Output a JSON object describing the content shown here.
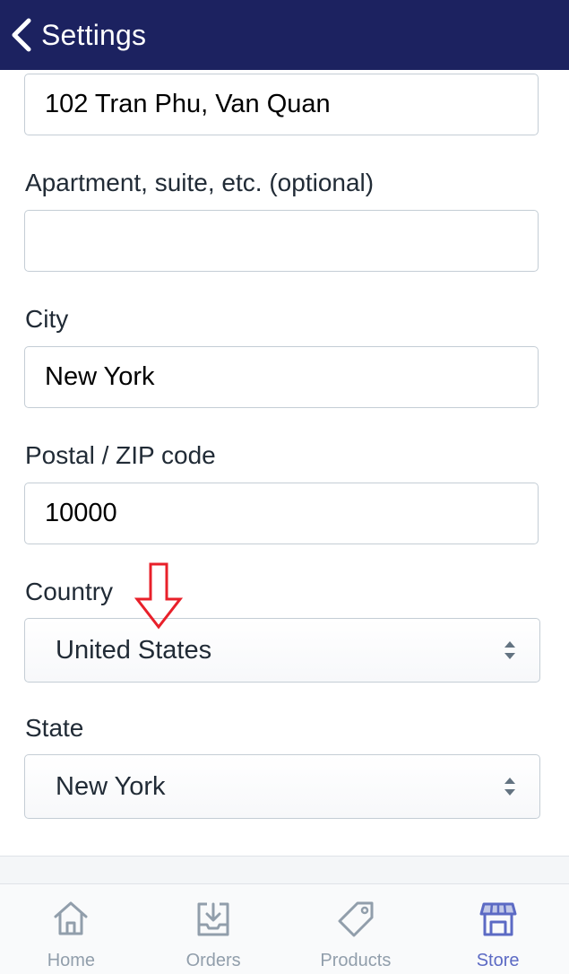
{
  "header": {
    "title": "Settings"
  },
  "form": {
    "address": {
      "value": "102 Tran Phu, Van Quan"
    },
    "apartment": {
      "label": "Apartment, suite, etc. (optional)",
      "value": ""
    },
    "city": {
      "label": "City",
      "value": "New York"
    },
    "postal": {
      "label": "Postal / ZIP code",
      "value": "10000"
    },
    "country": {
      "label": "Country",
      "selected": "United States"
    },
    "state": {
      "label": "State",
      "selected": "New York"
    }
  },
  "annotation": {
    "icon": "red-down-arrow-icon",
    "color": "#e8202a"
  },
  "tabbar": {
    "tabs": [
      {
        "label": "Home",
        "icon": "home-icon"
      },
      {
        "label": "Orders",
        "icon": "orders-tray-icon"
      },
      {
        "label": "Products",
        "icon": "tag-icon"
      },
      {
        "label": "Store",
        "icon": "store-icon"
      }
    ],
    "active": "Store",
    "active_color": "#5c6ac4",
    "inactive_color": "#919eab"
  },
  "colors": {
    "header_bg": "#1c2260"
  }
}
